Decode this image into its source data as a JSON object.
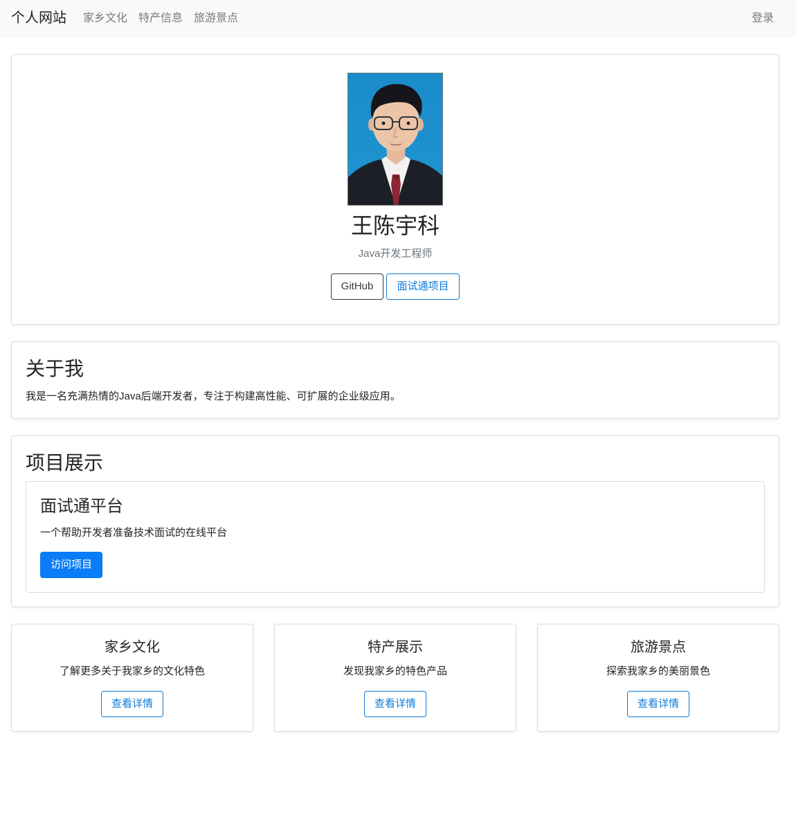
{
  "navbar": {
    "brand": "个人网站",
    "links": [
      "家乡文化",
      "特产信息",
      "旅游景点"
    ],
    "login": "登录"
  },
  "profile": {
    "name": "王陈宇科",
    "title": "Java开发工程师",
    "buttons": [
      "GitHub",
      "面试通项目"
    ]
  },
  "about": {
    "heading": "关于我",
    "text": "我是一名充满热情的Java后端开发者，专注于构建高性能、可扩展的企业级应用。"
  },
  "projects": {
    "heading": "项目展示",
    "items": [
      {
        "title": "面试通平台",
        "desc": "一个帮助开发者准备技术面试的在线平台",
        "button": "访问项目"
      }
    ]
  },
  "features": [
    {
      "title": "家乡文化",
      "desc": "了解更多关于我家乡的文化特色",
      "button": "查看详情"
    },
    {
      "title": "特产展示",
      "desc": "发现我家乡的特色产品",
      "button": "查看详情"
    },
    {
      "title": "旅游景点",
      "desc": "探索我家乡的美丽景色",
      "button": "查看详情"
    }
  ],
  "colors": {
    "navbar_bg": "#f8f9fa",
    "primary": "#0a7cf5",
    "outline_blue": "#0d7bd6",
    "photo_bg": "#1f95d1"
  }
}
